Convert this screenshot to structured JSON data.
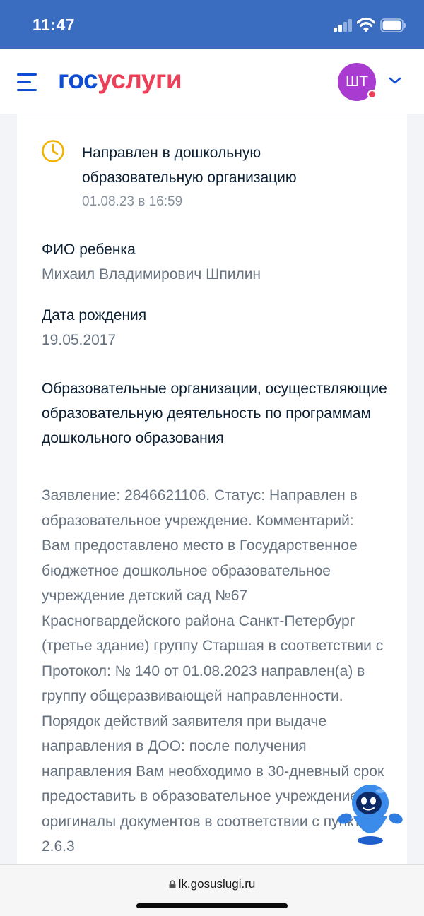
{
  "status_bar": {
    "time": "11:47"
  },
  "header": {
    "logo_part1": "гос",
    "logo_part2": "услуги",
    "avatar_initials": "ШТ",
    "brand_blue": "#0d4cd3",
    "brand_red": "#ee3f58",
    "avatar_color": "#a93bd0"
  },
  "application": {
    "status_title": "Направлен в дошкольную образовательную организацию",
    "status_date": "01.08.23 в 16:59",
    "child_name_label": "ФИО ребенка",
    "child_name": "Михаил Владимирович Шпилин",
    "birth_date_label": "Дата рождения",
    "birth_date": "19.05.2017",
    "section_title": "Образовательные организации, осуществляющие образовательную деятельность по программам дошкольного образования",
    "body_text": "Заявление: 2846621106. Статус: Направлен в образовательное учреждение. Комментарий: Вам предоставлено место в Государственное бюджетное дошкольное образовательное учреждение детский сад №67 Красногвардейского района Санкт-Петербург (третье здание) группу Старшая в соответствии с Протокол: № 140 от 01.08.2023 направлен(а) в группу общеразвивающей направленности. Порядок действий заявителя при выдаче направления в ДОО: после получения направления Вам необходимо в 30-дневный срок предоставить в образовательное учреждение оригиналы документов в соответствии с пунктом 2.6.3"
  },
  "browser": {
    "url": "lk.gosuslugi.ru"
  },
  "icons": {
    "menu": "hamburger-menu-icon",
    "status": "clock-icon",
    "account": "chevron-down-icon",
    "assistant": "robot-assistant-icon",
    "secure": "lock-icon"
  }
}
